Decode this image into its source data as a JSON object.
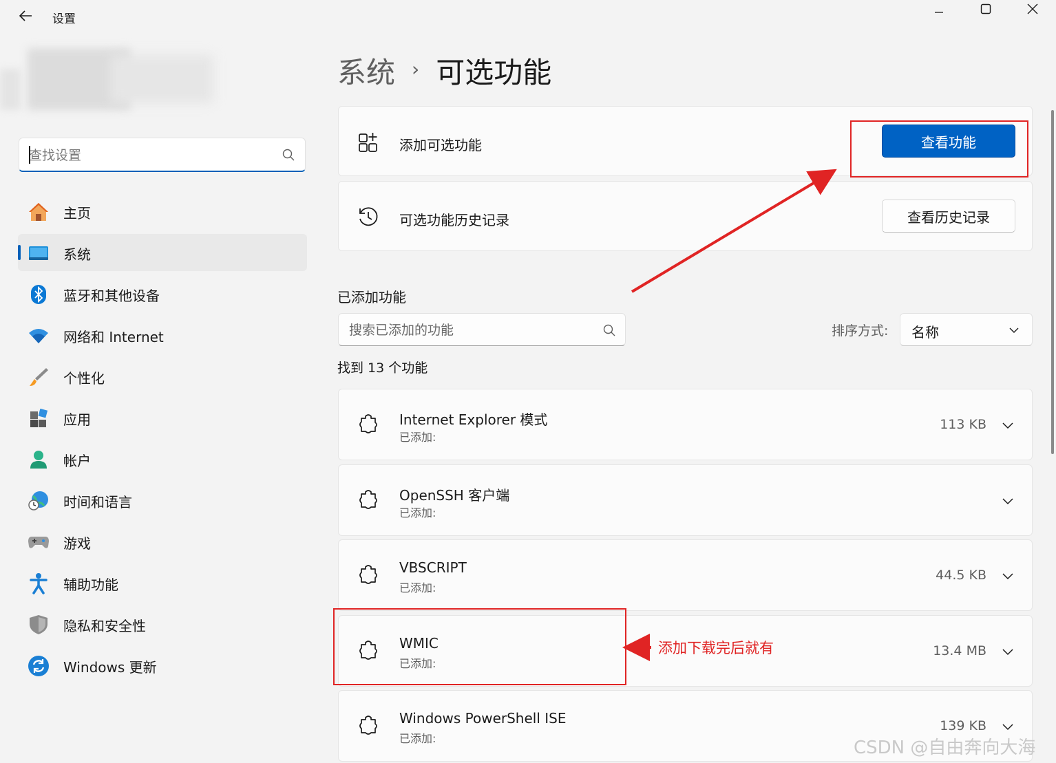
{
  "window": {
    "app_title": "设置"
  },
  "sidebar": {
    "search_placeholder": "查找设置",
    "items": [
      {
        "label": "主页",
        "icon": "home-icon"
      },
      {
        "label": "系统",
        "icon": "system-icon",
        "active": true
      },
      {
        "label": "蓝牙和其他设备",
        "icon": "bluetooth-icon"
      },
      {
        "label": "网络和 Internet",
        "icon": "wifi-icon"
      },
      {
        "label": "个性化",
        "icon": "brush-icon"
      },
      {
        "label": "应用",
        "icon": "apps-icon"
      },
      {
        "label": "帐户",
        "icon": "account-icon"
      },
      {
        "label": "时间和语言",
        "icon": "globe-clock-icon"
      },
      {
        "label": "游戏",
        "icon": "gamepad-icon"
      },
      {
        "label": "辅助功能",
        "icon": "accessibility-icon"
      },
      {
        "label": "隐私和安全性",
        "icon": "shield-icon"
      },
      {
        "label": "Windows 更新",
        "icon": "update-icon"
      }
    ]
  },
  "main": {
    "breadcrumb": {
      "parent": "系统",
      "separator": "›",
      "current": "可选功能"
    },
    "add_feature": {
      "title": "添加可选功能",
      "button": "查看功能"
    },
    "history": {
      "title": "可选功能历史记录",
      "button": "查看历史记录"
    },
    "installed": {
      "section_title": "已添加功能",
      "search_placeholder": "搜索已添加的功能",
      "sort_label": "排序方式:",
      "sort_value": "名称",
      "found_count": "找到 13 个功能",
      "features": [
        {
          "name": "Internet Explorer 模式",
          "status": "已添加:",
          "size": "113 KB"
        },
        {
          "name": "OpenSSH 客户端",
          "status": "已添加:",
          "size": ""
        },
        {
          "name": "VBSCRIPT",
          "status": "已添加:",
          "size": "44.5 KB"
        },
        {
          "name": "WMIC",
          "status": "已添加:",
          "size": "13.4 MB"
        },
        {
          "name": "Windows PowerShell ISE",
          "status": "已添加:",
          "size": "139 KB"
        }
      ]
    }
  },
  "annotations": {
    "wmic_note": "添加下载完后就有",
    "color": "#e02424"
  },
  "watermark": "CSDN @自由奔向大海",
  "colors": {
    "accent": "#005fb8",
    "primary_button": "#0062c4"
  }
}
